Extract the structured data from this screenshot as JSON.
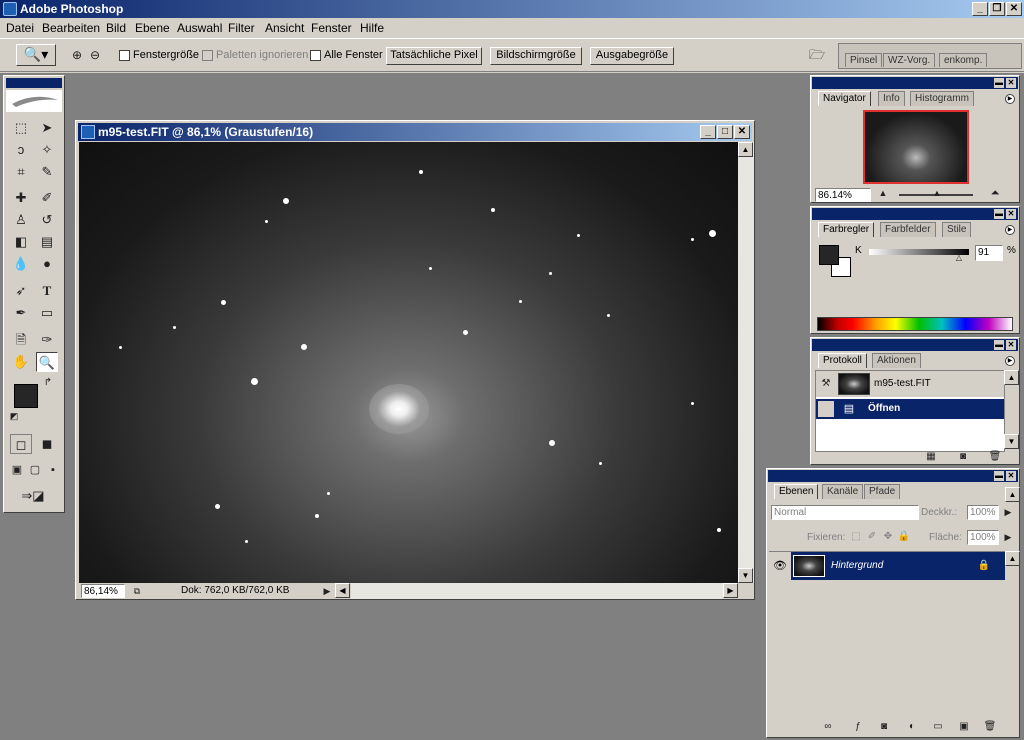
{
  "app": {
    "title": "Adobe Photoshop"
  },
  "menu": {
    "items": [
      "Datei",
      "Bearbeiten",
      "Bild",
      "Ebene",
      "Auswahl",
      "Filter",
      "Ansicht",
      "Fenster",
      "Hilfe"
    ]
  },
  "options": {
    "fenstergroesse": "Fenstergröße",
    "paletten_ignorieren": "Paletten ignorieren",
    "alle_fenster": "Alle Fenster",
    "tatsaechliche_pixel": "Tatsächliche Pixel",
    "bildschirmgroesse": "Bildschirmgröße",
    "ausgabegroesse": "Ausgabegröße",
    "well_tabs": [
      "Pinsel",
      "WZ-Vorg.",
      "enkomp."
    ]
  },
  "document": {
    "title": "m95-test.FIT @ 86,1% (Graustufen/16)",
    "zoom": "86,14%",
    "status": "Dok: 762,0 KB/762,0 KB"
  },
  "navigator": {
    "tabs": [
      "Navigator",
      "Info",
      "Histogramm"
    ],
    "zoom": "86.14%"
  },
  "color": {
    "tabs": [
      "Farbregler",
      "Farbfelder",
      "Stile"
    ],
    "channel_label": "K",
    "value": "91",
    "unit": "%"
  },
  "history": {
    "tabs": [
      "Protokoll",
      "Aktionen"
    ],
    "snapshot": "m95-test.FIT",
    "step": "Öffnen"
  },
  "layers": {
    "tabs": [
      "Ebenen",
      "Kanäle",
      "Pfade"
    ],
    "blend_mode": "Normal",
    "opacity_label": "Deckkr.:",
    "opacity": "100%",
    "lock_label": "Fixieren:",
    "fill_label": "Fläche:",
    "fill": "100%",
    "layer_name": "Hintergrund"
  }
}
